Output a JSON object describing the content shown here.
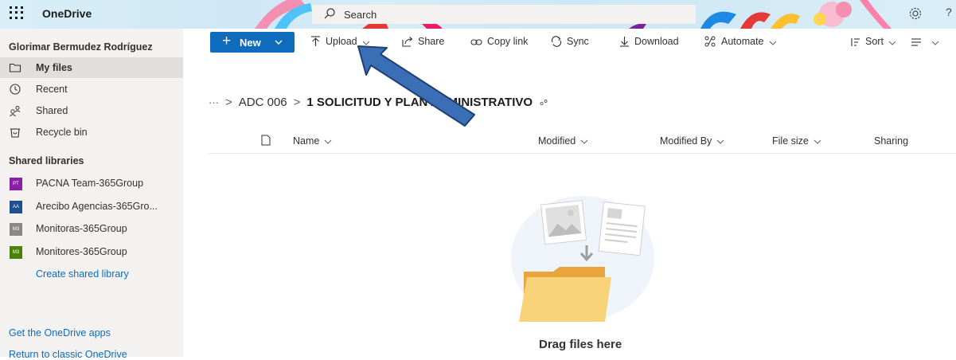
{
  "app": {
    "brand": "OneDrive",
    "search_placeholder": "Search"
  },
  "sidebar": {
    "user_name": "Glorimar Bermudez Rodríguez",
    "items": [
      {
        "label": "My files",
        "icon": "folder-icon",
        "active": true
      },
      {
        "label": "Recent",
        "icon": "clock-icon"
      },
      {
        "label": "Shared",
        "icon": "people-icon"
      },
      {
        "label": "Recycle bin",
        "icon": "recycle-bin-icon"
      }
    ],
    "libraries_title": "Shared libraries",
    "libraries": [
      {
        "label": "PACNA Team-365Group",
        "badge": "PT",
        "color": "#8b1fa8"
      },
      {
        "label": "Arecibo Agencias-365Gro...",
        "badge": "AA",
        "color": "#1f4e8c"
      },
      {
        "label": "Monitoras-365Group",
        "badge": "M3",
        "color": "#8a8886"
      },
      {
        "label": "Monitores-365Group",
        "badge": "M3",
        "color": "#498205"
      }
    ],
    "create_library": "Create shared library",
    "get_apps": "Get the OneDrive apps",
    "classic": "Return to classic OneDrive"
  },
  "toolbar": {
    "new_label": "New",
    "upload_label": "Upload",
    "share_label": "Share",
    "copy_link_label": "Copy link",
    "sync_label": "Sync",
    "download_label": "Download",
    "automate_label": "Automate",
    "sort_label": "Sort"
  },
  "breadcrumb": {
    "more": "···",
    "parent": "ADC 006",
    "current": "1 SOLICITUD Y PLAN ADMINISTRATIVO"
  },
  "list": {
    "columns": [
      "Name",
      "Modified",
      "Modified By",
      "File size",
      "Sharing"
    ]
  },
  "empty_state": {
    "text": "Drag files here"
  },
  "colors": {
    "accent": "#0f6cbd",
    "arrow": "#3a6fb5"
  }
}
